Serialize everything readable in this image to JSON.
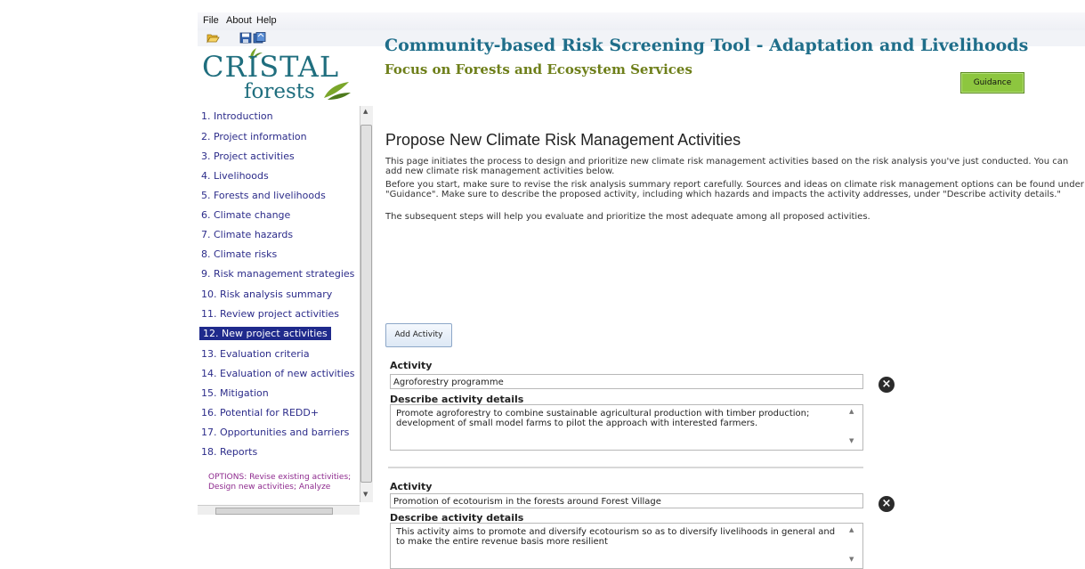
{
  "menu": [
    "File",
    "About",
    "Help"
  ],
  "header": {
    "logo_top": "CRISTAL",
    "logo_bottom": "forests",
    "title": "Community-based Risk Screening Tool - Adaptation and Livelihoods",
    "subtitle": "Focus on Forests and Ecosystem Services",
    "guidance_button": "Guidance"
  },
  "sidebar": {
    "items": [
      {
        "label": "1. Introduction"
      },
      {
        "label": "2. Project information"
      },
      {
        "label": "3. Project activities"
      },
      {
        "label": "4. Livelihoods"
      },
      {
        "label": "5. Forests and livelihoods"
      },
      {
        "label": "6. Climate change"
      },
      {
        "label": "7. Climate hazards"
      },
      {
        "label": "8. Climate risks"
      },
      {
        "label": "9. Risk management strategies"
      },
      {
        "label": "10. Risk analysis summary"
      },
      {
        "label": "11. Review project activities"
      },
      {
        "label": "12. New project activities",
        "active": true
      },
      {
        "label": "13. Evaluation criteria"
      },
      {
        "label": "14. Evaluation of new activities"
      },
      {
        "label": "15. Mitigation"
      },
      {
        "label": "16. Potential for REDD+"
      },
      {
        "label": "17. Opportunities and barriers"
      },
      {
        "label": "18. Reports"
      }
    ],
    "options_line1": "OPTIONS: Revise existing activities;",
    "options_line2": "Design new activities; Analyze"
  },
  "main": {
    "heading": "Propose New Climate Risk Management Activities",
    "intro": "This page initiates the process to design and prioritize new climate risk management activities based on the risk analysis you've just conducted. You can add new climate risk management activities below.",
    "before": "Before you start, make sure to revise the risk analysis summary report carefully. Sources and ideas on climate risk management options can be found under \"Guidance\". Make sure to describe the proposed activity, including which hazards and impacts the activity addresses, under \"Describe activity details.\"",
    "subsequent": "The subsequent steps will help you evaluate and prioritize the most adequate among all proposed activities.",
    "add_button": "Add Activity",
    "activity_label": "Activity",
    "details_label": "Describe activity details",
    "activities": [
      {
        "name": "Agroforestry programme",
        "details": "Promote agroforestry to combine sustainable agricultural production with timber production; development of small model farms to pilot the approach with interested farmers."
      },
      {
        "name": "Promotion of ecotourism in the forests around Forest Village",
        "details": "This activity aims to promote and diversify ecotourism so as to diversify livelihoods in general and to make the entire revenue basis more resilient"
      }
    ]
  },
  "icons": {
    "open": "folder-open-icon",
    "save": "save-icon",
    "delete": "delete-icon"
  },
  "colors": {
    "title": "#1f6e8a",
    "subtitle": "#6e7f1a",
    "guidance_button": "#8dc63f",
    "nav_text": "#2c2c8a",
    "nav_active_bg": "#1f2a8c",
    "options_text": "#8e2a8e"
  }
}
